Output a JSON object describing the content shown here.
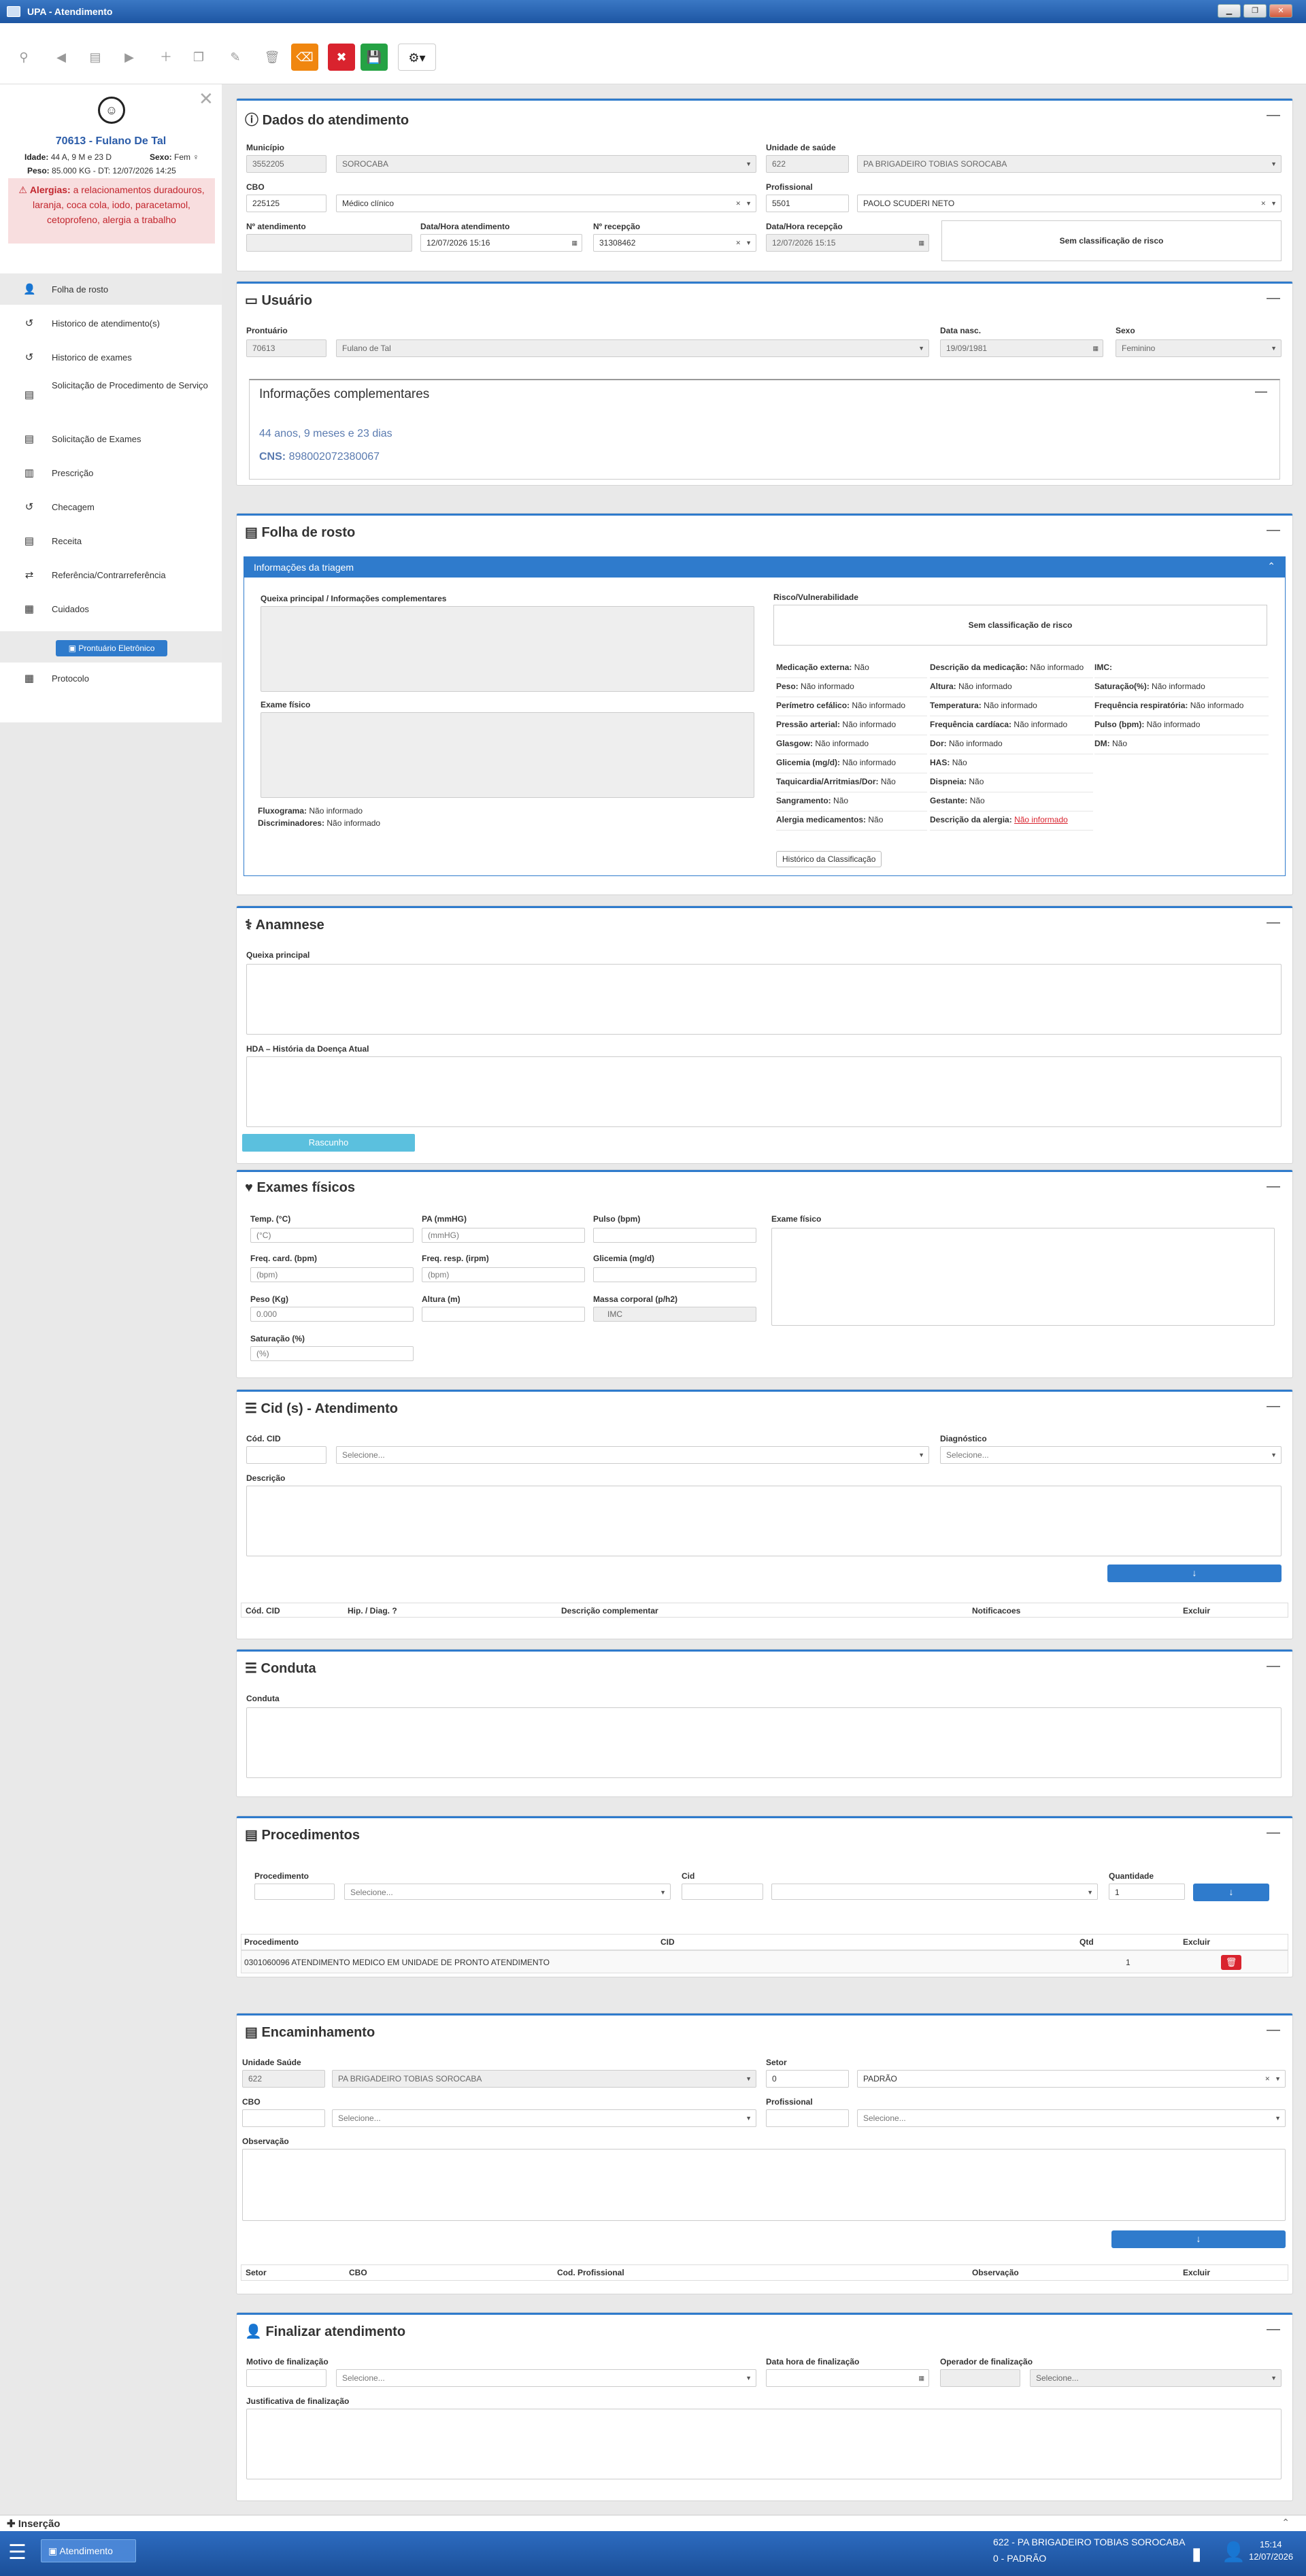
{
  "window": {
    "title": "UPA - Atendimento"
  },
  "sidebar": {
    "patient_name": "70613 - Fulano De Tal",
    "idade_label": "Idade:",
    "idade": "44 A, 9 M e 23 D",
    "sexo_label": "Sexo:",
    "sexo": "Fem",
    "peso_label": "Peso:",
    "peso": "85.000 KG - DT: 12/07/2026 14:25",
    "alergias_label": "Alergias:",
    "alergias": "a relacionamentos duradouros, laranja, coca cola, iodo, paracetamol, cetoprofeno, alergia a trabalho",
    "menu": [
      "Folha de rosto",
      "Historico de atendimento(s)",
      "Historico de exames",
      "Solicitação de Procedimento de Serviço",
      "Solicitação de Exames",
      "Prescrição",
      "Checagem",
      "Receita",
      "Referência/Contrarreferência",
      "Cuidados"
    ],
    "prontuario_button": "Prontuário Eletrônico",
    "protocolo": "Protocolo"
  },
  "dados": {
    "title": "Dados do atendimento",
    "municipio_label": "Município",
    "municipio_code": "3552205",
    "municipio": "SOROCABA",
    "unidade_label": "Unidade de saúde",
    "unidade_code": "622",
    "unidade": "PA BRIGADEIRO TOBIAS SOROCABA",
    "cbo_label": "CBO",
    "cbo_code": "225125",
    "cbo": "Médico clínico",
    "prof_label": "Profissional",
    "prof_code": "5501",
    "prof": "PAOLO SCUDERI NETO",
    "natend_label": "Nº atendimento",
    "natend": "",
    "dtatend_label": "Data/Hora atendimento",
    "dtatend": "12/07/2026 15:16",
    "nrecep_label": "Nº recepção",
    "nrecep": "31308462",
    "dtrecep_label": "Data/Hora recepção",
    "dtrecep": "12/07/2026 15:15",
    "risco": "Sem classificação de risco"
  },
  "usuario": {
    "title": "Usuário",
    "prontuario_label": "Prontuário",
    "prontuario": "70613",
    "nome": "Fulano de Tal",
    "nasc_label": "Data nasc.",
    "nasc": "19/09/1981",
    "sexo_label": "Sexo",
    "sexo": "Feminino",
    "info_title": "Informações complementares",
    "idade": "44 anos, 9 meses e 23 dias",
    "cns_label": "CNS:",
    "cns": "898002072380067"
  },
  "folha": {
    "title": "Folha de rosto",
    "triagem_title": "Informações da triagem",
    "queixa_label": "Queixa principal / Informações complementares",
    "exame_label": "Exame físico",
    "fluxograma_label": "Fluxograma:",
    "fluxograma": "Não informado",
    "discriminadores_label": "Discriminadores:",
    "discriminadores": "Não informado",
    "risco_label": "Risco/Vulnerabilidade",
    "risco": "Sem classificação de risco",
    "col1": [
      [
        "Medicação externa:",
        "Não"
      ],
      [
        "Peso:",
        "Não informado"
      ],
      [
        "Perímetro cefálico:",
        "Não informado"
      ],
      [
        "Pressão arterial:",
        "Não informado"
      ],
      [
        "Glasgow:",
        "Não informado"
      ],
      [
        "Glicemia (mg/d):",
        "Não informado"
      ],
      [
        "Taquicardia/Arritmias/Dor:",
        "Não"
      ],
      [
        "Sangramento:",
        "Não"
      ],
      [
        "Alergia medicamentos:",
        "Não"
      ]
    ],
    "col2": [
      [
        "Descrição da medicação:",
        "Não informado"
      ],
      [
        "Altura:",
        "Não informado"
      ],
      [
        "Temperatura:",
        "Não informado"
      ],
      [
        "Frequência cardíaca:",
        "Não informado"
      ],
      [
        "Dor:",
        "Não informado"
      ],
      [
        "HAS:",
        "Não"
      ],
      [
        "Dispneia:",
        "Não"
      ],
      [
        "Gestante:",
        "Não"
      ],
      [
        "Descrição da alergia:",
        "Não informado"
      ]
    ],
    "col3": [
      [
        "IMC:",
        ""
      ],
      [
        "Saturação(%):",
        "Não informado"
      ],
      [
        "Frequência respiratória:",
        "Não informado"
      ],
      [
        "Pulso (bpm):",
        "Não informado"
      ],
      [
        "DM:",
        "Não"
      ]
    ],
    "historico_button": "Histórico da Classificação"
  },
  "anamnese": {
    "title": "Anamnese",
    "queixa_label": "Queixa principal",
    "hda_label": "HDA – História da Doença Atual",
    "rascunho": "Rascunho"
  },
  "exames": {
    "title": "Exames físicos",
    "temp_label": "Temp. (°C)",
    "temp_ph": "(°C)",
    "pa_label": "PA (mmHG)",
    "pa_ph": "(mmHG)",
    "pulso_label": "Pulso (bpm)",
    "exame_label": "Exame físico",
    "fc_label": "Freq. card. (bpm)",
    "fc_ph": "(bpm)",
    "fr_label": "Freq. resp. (irpm)",
    "fr_ph": "(bpm)",
    "glic_label": "Glicemia (mg/d)",
    "peso_label": "Peso (Kg)",
    "peso_ph": "0.000",
    "altura_label": "Altura (m)",
    "massa_label": "Massa corporal (p/h2)",
    "massa_ph": "IMC",
    "sat_label": "Saturação (%)",
    "sat_ph": "(%)"
  },
  "cid": {
    "title": "Cid (s) - Atendimento",
    "cod_label": "Cód. CID",
    "sel_ph": "Selecione...",
    "diag_label": "Diagnóstico",
    "diag_ph": "Selecione...",
    "desc_label": "Descrição",
    "columns": [
      "Cód. CID",
      "Hip. / Diag. ?",
      "Descrição complementar",
      "Notificacoes",
      "Excluir"
    ]
  },
  "conduta": {
    "title": "Conduta",
    "label": "Conduta"
  },
  "proc": {
    "title": "Procedimentos",
    "proc_label": "Procedimento",
    "proc_ph": "Selecione...",
    "cid_label": "Cid",
    "qtd_label": "Quantidade",
    "qtd": "1",
    "columns": [
      "Procedimento",
      "CID",
      "Qtd",
      "Excluir"
    ],
    "rows": [
      {
        "procedimento": "0301060096 ATENDIMENTO MEDICO EM UNIDADE DE PRONTO ATENDIMENTO",
        "cid": "",
        "qtd": "1"
      }
    ]
  },
  "enc": {
    "title": "Encaminhamento",
    "unidade_label": "Unidade Saúde",
    "unidade_code": "622",
    "unidade": "PA BRIGADEIRO TOBIAS SOROCABA",
    "setor_label": "Setor",
    "setor_code": "0",
    "setor": "PADRÃO",
    "cbo_label": "CBO",
    "cbo_ph": "Selecione...",
    "prof_label": "Profissional",
    "prof_ph": "Selecione...",
    "obs_label": "Observação",
    "columns": [
      "Setor",
      "CBO",
      "Cod. Profissional",
      "Observação",
      "Excluir"
    ]
  },
  "fin": {
    "title": "Finalizar atendimento",
    "motivo_label": "Motivo de finalização",
    "motivo_ph": "Selecione...",
    "data_label": "Data hora de finalização",
    "operador_label": "Operador de finalização",
    "operador_ph": "Selecione...",
    "just_label": "Justificativa de finalização"
  },
  "status": {
    "insercao": "Inserção"
  },
  "taskbar": {
    "app": "Atendimento",
    "unit": "622 - PA BRIGADEIRO TOBIAS SOROCABA",
    "setor": "0 - PADRÃO",
    "time": "15:14",
    "date": "12/07/2026"
  }
}
